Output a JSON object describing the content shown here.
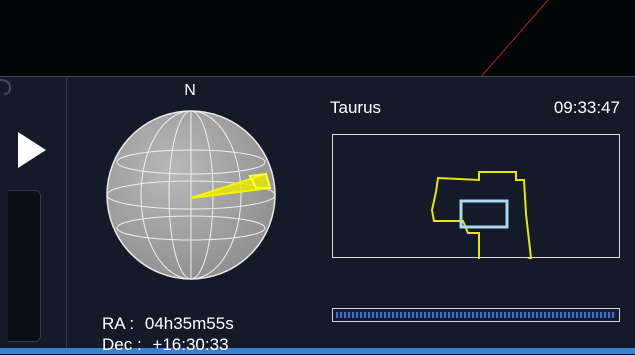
{
  "compass": {
    "north_label": "N"
  },
  "target": {
    "constellation": "Taurus",
    "time": "09:33:47",
    "ra_label": "RA :",
    "ra_value": "04h35m55s",
    "dec_label": "Dec :",
    "dec_value": "+16:30:33"
  },
  "progress": {
    "fraction": 1.0
  },
  "icons": {
    "play": "play-icon",
    "globe": "celestial-globe-icon"
  },
  "colors": {
    "panel": "#151a29",
    "accent_yellow": "#e6e600",
    "frame_blue": "#a9d8f0",
    "progress_blue": "#3f6fd0",
    "sky_line": "#b52020"
  }
}
